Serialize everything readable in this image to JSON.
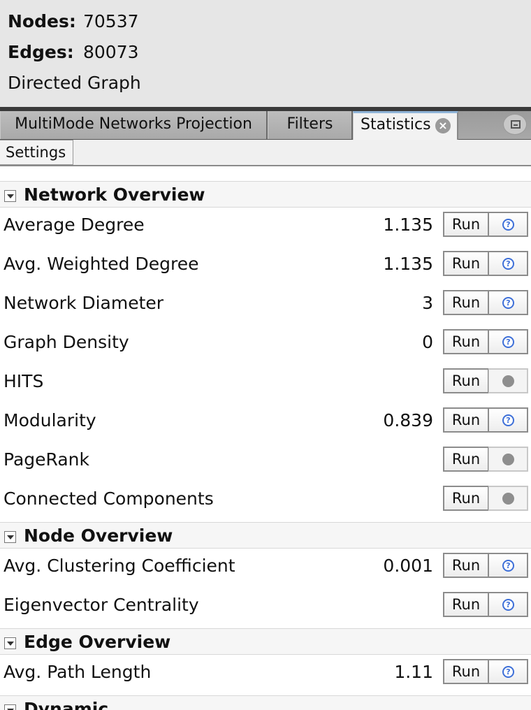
{
  "summary": {
    "nodes_label": "Nodes:",
    "nodes_value": "70537",
    "edges_label": "Edges:",
    "edges_value": "80073",
    "graph_type": "Directed Graph"
  },
  "tabs": {
    "multimode": "MultiMode Networks Projection",
    "filters": "Filters",
    "statistics": "Statistics",
    "close_glyph": "×"
  },
  "toolbar": {
    "settings_label": "Settings"
  },
  "sections": {
    "network": "Network Overview",
    "node": "Node Overview",
    "edge": "Edge Overview",
    "dynamic": "Dynamic"
  },
  "stats": [
    {
      "name": "Average Degree",
      "value": "1.135",
      "run": "Run",
      "help_icon": "question-icon"
    },
    {
      "name": "Avg. Weighted Degree",
      "value": "1.135",
      "run": "Run",
      "help_icon": "question-icon"
    },
    {
      "name": "Network Diameter",
      "value": "3",
      "run": "Run",
      "help_icon": "question-icon"
    },
    {
      "name": "Graph Density",
      "value": "0",
      "run": "Run",
      "help_icon": "question-icon"
    },
    {
      "name": "HITS",
      "value": "",
      "run": "Run",
      "help_icon": "disabled-dot-icon"
    },
    {
      "name": "Modularity",
      "value": "0.839",
      "run": "Run",
      "help_icon": "question-icon"
    },
    {
      "name": "PageRank",
      "value": "",
      "run": "Run",
      "help_icon": "disabled-dot-icon"
    },
    {
      "name": "Connected Components",
      "value": "",
      "run": "Run",
      "help_icon": "disabled-dot-icon"
    },
    {
      "name": "Avg. Clustering Coefficient",
      "value": "0.001",
      "run": "Run",
      "help_icon": "question-icon"
    },
    {
      "name": "Eigenvector Centrality",
      "value": "",
      "run": "Run",
      "help_icon": "question-icon"
    },
    {
      "name": "Avg. Path Length",
      "value": "1.11",
      "run": "Run",
      "help_icon": "question-icon"
    }
  ],
  "colors": {
    "help_icon": "#3d6fd8",
    "active_tab_accent": "#8fb4d8"
  }
}
